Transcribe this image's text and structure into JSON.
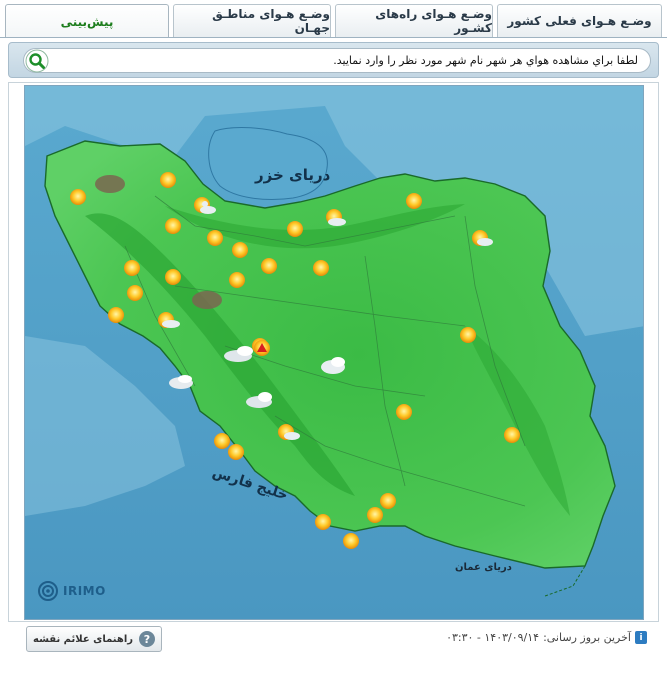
{
  "tabs": [
    {
      "label": "وضـع هـوای فعلی کشور",
      "active": false
    },
    {
      "label": "وضـع هـوای راه‌های کشـور",
      "active": false
    },
    {
      "label": "وضـع هـوای مناطـق جهـان",
      "active": false
    },
    {
      "label": "پیش‌بینی",
      "active": true
    }
  ],
  "search": {
    "placeholder": "لطفا براي مشاهده هواي هر شهر نام شهر مورد نظر را وارد نماييد.",
    "icon": "search-icon"
  },
  "map": {
    "labels": {
      "caspian": "دریای خزر",
      "persian_gulf": "خلیج فارس",
      "sea_of_oman": "دریای عمان"
    },
    "colors": {
      "sea": "#4f9ec6",
      "land": "#44c14a",
      "highland": "#2aa532",
      "sun": "#f7b21e"
    },
    "logo_text": "IRIMO",
    "icons": [
      "sun-icon",
      "cloudy-icon",
      "partly-cloudy-icon",
      "dust-icon",
      "storm-warning-icon"
    ]
  },
  "footer": {
    "legend_button": "راهنمای علائم نقشه",
    "last_update_label": "آخرین بروز رسانی:",
    "last_update_value": "۱۴۰۳/۰۹/۱۴ - ۰۳:۳۰"
  }
}
